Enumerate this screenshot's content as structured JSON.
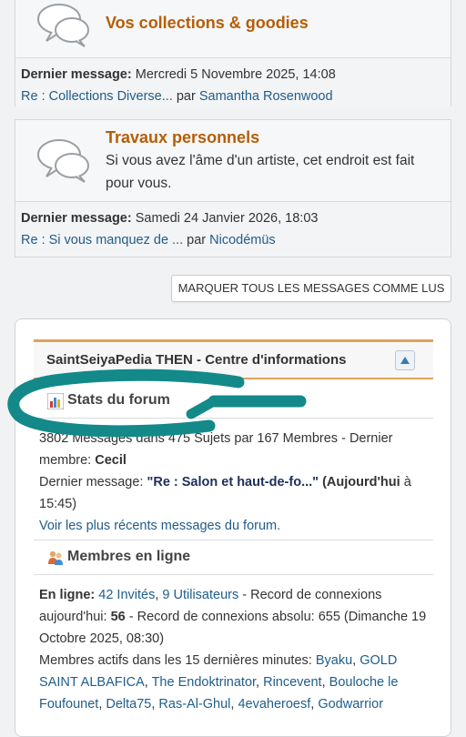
{
  "forums": [
    {
      "title": "Vos collections & goodies",
      "description": "",
      "last_label": "Dernier message:",
      "last_date": "Mercredi 5 Novembre 2025, 14:08",
      "last_topic": "Re : Collections Diverse...",
      "by": "par",
      "last_author": "Samantha Rosenwood"
    },
    {
      "title": "Travaux personnels",
      "description": "Si vous avez l'âme d'un artiste, cet endroit est fait pour vous.",
      "last_label": "Dernier message:",
      "last_date": "Samedi 24 Janvier 2026, 18:03",
      "last_topic": "Re : Si vous manquez de ...",
      "by": "par",
      "last_author": "Nicodémüs"
    }
  ],
  "mark_all_read": "MARQUER TOUS LES MESSAGES COMME LUS",
  "info": {
    "title": "SaintSeiyaPedia THEN - Centre d'informations",
    "stats": {
      "heading": "Stats du forum",
      "line1": "3802 Messages dans 475 Sujets par 167 Membres - Dernier",
      "member_prefix": "membre:",
      "member_name": "Cecil",
      "last_prefix": "Dernier message:",
      "last_topic": "\"Re : Salon et haut-de-fo...\"",
      "last_when": "(Aujourd'hui",
      "last_at": "à",
      "last_time": "15:45)",
      "recent_link": "Voir les plus récents messages du forum."
    },
    "online": {
      "heading": "Membres en ligne",
      "label": "En ligne:",
      "guests": "42 Invités",
      "sep": ",",
      "users": "9 Utilisateurs",
      "record_text": " - Record de connexions aujourd'hui:",
      "record_today": "56",
      "record_abs": " - Record de connexions absolu: 655 (Dimanche 19 Octobre 2025, 08:30)",
      "active_label": "Membres actifs dans les 15 dernières minutes:",
      "members": [
        "Byaku",
        "GOLD SAINT ALBAFICA",
        "The Endoktrinator",
        "Rincevent",
        "Bouloche le Foufounet",
        "Delta75",
        "Ras-Al-Ghul",
        "4evaheroesf",
        "Godwarrior"
      ]
    }
  },
  "colors": {
    "forum_title": "#b65d07",
    "link": "#1f5d8a",
    "header_accent": "#e0a35a",
    "annotation": "#13898a"
  },
  "icons": [
    "speech-bubbles-icon",
    "bar-chart-icon",
    "members-icon",
    "arrow-up-icon"
  ]
}
